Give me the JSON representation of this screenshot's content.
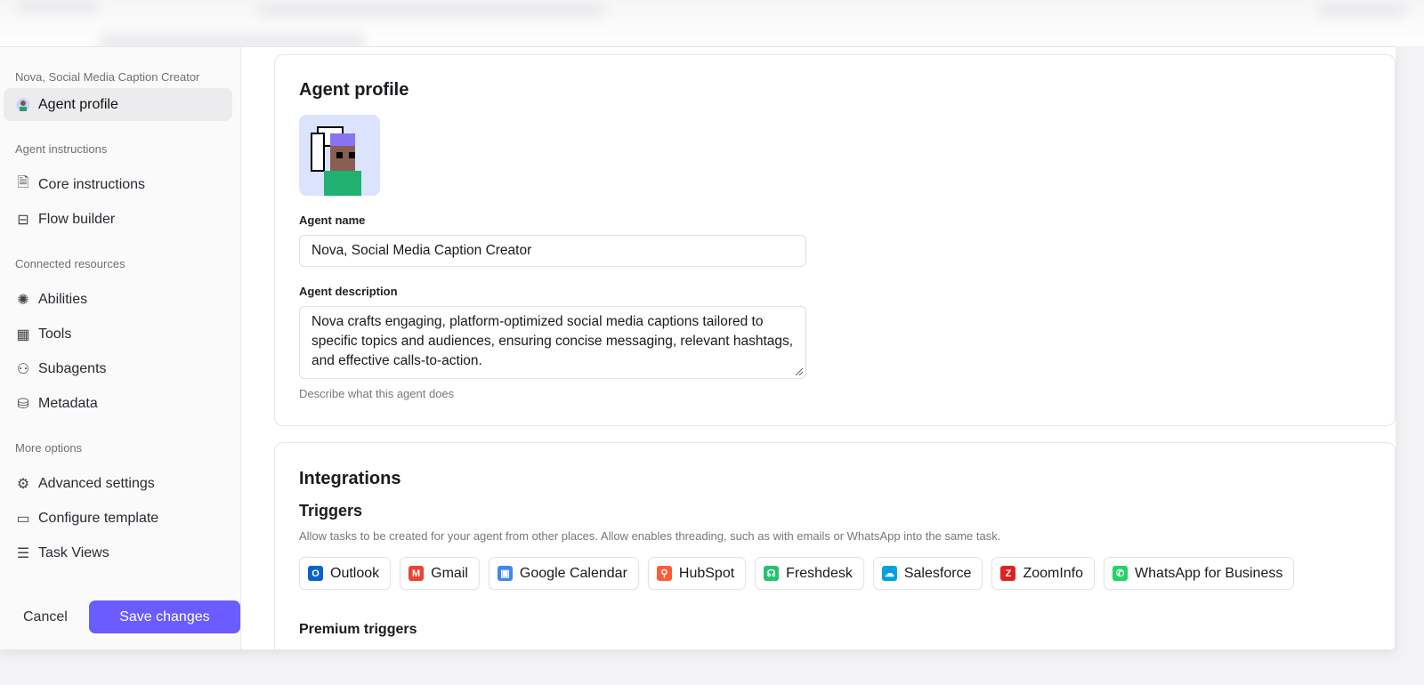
{
  "sidebar": {
    "agent_title": "Nova, Social Media Caption Creator",
    "active_item": "Agent profile",
    "sections": [
      {
        "label": "Agent instructions",
        "items": [
          {
            "label": "Core instructions",
            "icon": "document-icon"
          },
          {
            "label": "Flow builder",
            "icon": "flow-icon"
          }
        ]
      },
      {
        "label": "Connected resources",
        "items": [
          {
            "label": "Abilities",
            "icon": "sparkle-icon"
          },
          {
            "label": "Tools",
            "icon": "tools-icon"
          },
          {
            "label": "Subagents",
            "icon": "hierarchy-icon"
          },
          {
            "label": "Metadata",
            "icon": "database-icon"
          }
        ]
      },
      {
        "label": "More options",
        "items": [
          {
            "label": "Advanced settings",
            "icon": "gear-icon"
          },
          {
            "label": "Configure template",
            "icon": "template-icon"
          },
          {
            "label": "Task Views",
            "icon": "list-icon"
          }
        ]
      }
    ],
    "cancel_label": "Cancel",
    "save_label": "Save changes",
    "accent": "#6b5cff"
  },
  "profile": {
    "title": "Agent profile",
    "name_label": "Agent name",
    "name_value": "Nova, Social Media Caption Creator",
    "description_label": "Agent description",
    "description_value": "Nova crafts engaging, platform-optimized social media captions tailored to specific topics and audiences, ensuring concise messaging, relevant hashtags, and effective calls-to-action.",
    "description_help": "Describe what this agent does"
  },
  "integrations": {
    "title": "Integrations",
    "triggers_title": "Triggers",
    "triggers_desc": "Allow tasks to be created for your agent from other places. Allow enables threading, such as with emails or WhatsApp into the same task.",
    "triggers": [
      {
        "label": "Outlook",
        "color": "#0a64c8",
        "glyph": "O"
      },
      {
        "label": "Gmail",
        "color": "#ea4335",
        "glyph": "M"
      },
      {
        "label": "Google Calendar",
        "color": "#4285f4",
        "glyph": "▣"
      },
      {
        "label": "HubSpot",
        "color": "#ff5c35",
        "glyph": "⚲"
      },
      {
        "label": "Freshdesk",
        "color": "#25c16f",
        "glyph": "☊"
      },
      {
        "label": "Salesforce",
        "color": "#00a1e0",
        "glyph": "☁"
      },
      {
        "label": "ZoomInfo",
        "color": "#e32121",
        "glyph": "Z"
      },
      {
        "label": "WhatsApp for Business",
        "color": "#25d366",
        "glyph": "✆"
      }
    ],
    "premium_title": "Premium triggers"
  }
}
